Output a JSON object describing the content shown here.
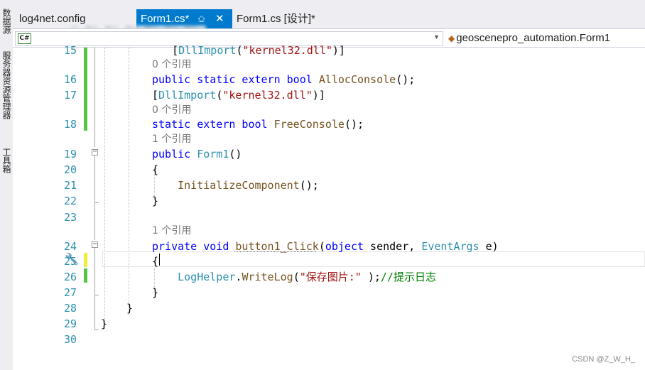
{
  "side_strip": [
    "数据源",
    "服务器资源管理器",
    "工具箱"
  ],
  "tabs": [
    {
      "label": "log4net.config",
      "active": false
    },
    {
      "label": "Form1.cs*",
      "active": true,
      "pin_icon": "pin-icon",
      "close_icon": "close-icon"
    },
    {
      "label": "Form1.cs [设计]*",
      "active": false
    }
  ],
  "navbar": {
    "project_badge": "C#",
    "class_name": "geoscenepro_automation.Form1"
  },
  "code": {
    "lines": [
      {
        "num": "15",
        "html": "<span class=\"pn\">    [</span><span class=\"ty\">DllImport</span><span class=\"pn\">(</span><span class=\"st\">\"kernel32.dll\"</span><span class=\"pn\">)]</span>"
      },
      {
        "num": "16",
        "html": "<span class=\"kw\">public static extern bool</span> <span class=\"mt\">AllocConsole</span><span class=\"pn\">();</span>"
      },
      {
        "num": "17",
        "html": "<span class=\"pn\">[</span><span class=\"ty\">DllImport</span><span class=\"pn\">(</span><span class=\"st\">\"kernel32.dll\"</span><span class=\"pn\">)]</span>"
      },
      {
        "num": "18",
        "html": "<span class=\"kw\">static extern bool</span> <span class=\"mt\">FreeConsole</span><span class=\"pn\">();</span>"
      },
      {
        "num": "19",
        "html": "<span class=\"kw\">public</span> <span class=\"ty\">Form1</span><span class=\"pn\">()</span>"
      },
      {
        "num": "20",
        "html": "<span class=\"pn\">{</span>"
      },
      {
        "num": "21",
        "html": "<span class=\"pn\">    </span><span class=\"mt\">InitializeComponent</span><span class=\"pn\">();</span>"
      },
      {
        "num": "22",
        "html": "<span class=\"pn\">}</span>"
      },
      {
        "num": "23",
        "html": ""
      },
      {
        "num": "24",
        "html": "<span class=\"kw\">private void</span> <span class=\"mt\">button1_Click</span><span class=\"pn\">(</span><span class=\"kw\">object</span><span class=\"pn\"> sender, </span><span class=\"ty\">EventArgs</span><span class=\"pn\"> e)</span>"
      },
      {
        "num": "25",
        "html": "<span class=\"pn\">{</span>"
      },
      {
        "num": "26",
        "html": "<span class=\"pn\">    </span><span class=\"ty\">LogHelper</span><span class=\"pn\">.</span><span class=\"mt\">WriteLog</span><span class=\"pn\">(</span><span class=\"st\">\"保存图片:\"</span><span class=\"pn\"> );</span><span class=\"cm\">//提示日志</span>"
      },
      {
        "num": "27",
        "html": "<span class=\"pn\">}</span>"
      },
      {
        "num": "28",
        "html": "<span class=\"pn\">}</span>"
      },
      {
        "num": "29",
        "html": "<span class=\"pn\">}</span>"
      },
      {
        "num": "30",
        "html": ""
      }
    ],
    "references": [
      "0 个引用",
      "0 个引用",
      "1 个引用",
      "1 个引用"
    ]
  },
  "watermark": "CSDN @Z_W_H_",
  "colors": {
    "accent": "#007acc",
    "keyword": "#0000ff",
    "type": "#2b91af",
    "string": "#a31515",
    "comment": "#008000",
    "line_number": "#2b91af",
    "change_saved": "#57c443",
    "change_unsaved": "#efef3a"
  }
}
